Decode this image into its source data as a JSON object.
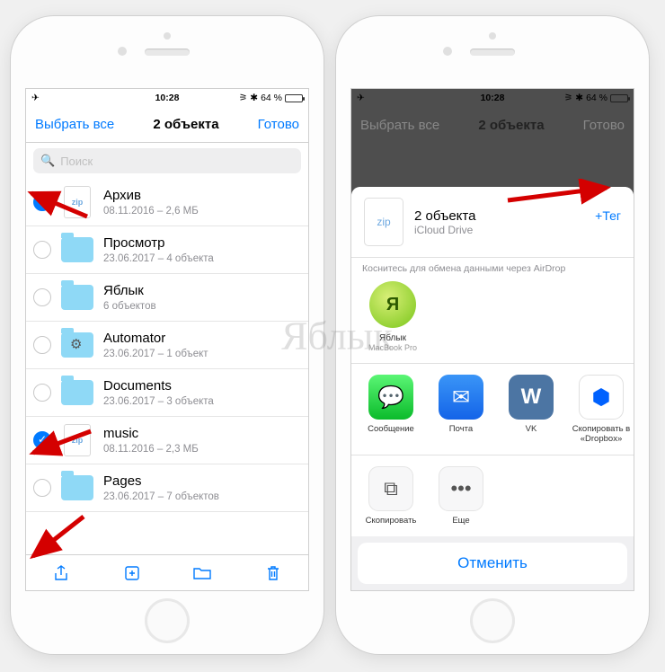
{
  "watermark": "Яблык",
  "status": {
    "time": "10:28",
    "battery": "64 %"
  },
  "left": {
    "nav": {
      "select_all": "Выбрать все",
      "title": "2 объекта",
      "done": "Готово"
    },
    "search_placeholder": "Поиск",
    "rows": [
      {
        "checked": true,
        "kind": "zip",
        "title": "Архив",
        "sub": "08.11.2016 – 2,6 МБ"
      },
      {
        "checked": false,
        "kind": "folder",
        "title": "Просмотр",
        "sub": "23.06.2017 – 4 объекта"
      },
      {
        "checked": false,
        "kind": "folder",
        "title": "Яблык",
        "sub": "6 объектов"
      },
      {
        "checked": false,
        "kind": "gear",
        "title": "Automator",
        "sub": "23.06.2017 – 1 объект"
      },
      {
        "checked": false,
        "kind": "folder",
        "title": "Documents",
        "sub": "23.06.2017 – 3 объекта"
      },
      {
        "checked": true,
        "kind": "zip",
        "title": "music",
        "sub": "08.11.2016 – 2,3 МБ"
      },
      {
        "checked": false,
        "kind": "folder",
        "title": "Pages",
        "sub": "23.06.2017 – 7 объектов"
      }
    ]
  },
  "right": {
    "nav": {
      "select_all": "Выбрать все",
      "title": "2 объекта",
      "done": "Готово"
    },
    "header": {
      "title": "2 объекта",
      "source": "iCloud Drive",
      "plus": "+Тег"
    },
    "airdrop": {
      "hint": "Коснитесь для обмена данными через AirDrop",
      "contact_name": "Яблык",
      "contact_device": "MacBook Pro",
      "avatar_letter": "Я"
    },
    "apps": [
      {
        "label": "Сообщение",
        "icon": "msg"
      },
      {
        "label": "Почта",
        "icon": "mail"
      },
      {
        "label": "VK",
        "icon": "vk"
      },
      {
        "label": "Скопировать в «Dropbox»",
        "icon": "dbx"
      }
    ],
    "actions": [
      {
        "label": "Скопировать",
        "icon": "copy"
      },
      {
        "label": "Еще",
        "icon": "more"
      }
    ],
    "cancel": "Отменить"
  }
}
